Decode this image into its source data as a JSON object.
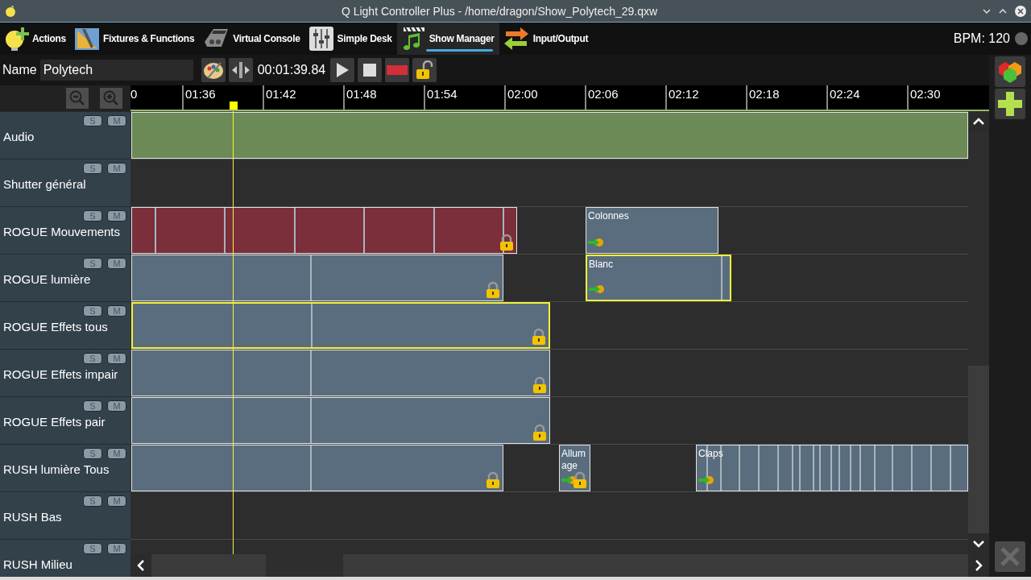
{
  "window": {
    "title": "Q Light Controller Plus - /home/dragon/Show_Polytech_29.qxw"
  },
  "tabs": [
    {
      "label": "Actions",
      "selected": false
    },
    {
      "label": "Fixtures & Functions",
      "selected": false
    },
    {
      "label": "Virtual Console",
      "selected": false
    },
    {
      "label": "Simple Desk",
      "selected": false
    },
    {
      "label": "Show Manager",
      "selected": true
    },
    {
      "label": "Input/Output",
      "selected": false
    }
  ],
  "bpm": "BPM: 120",
  "toolbar": {
    "name_label": "Name",
    "name_value": "Polytech",
    "time": "00:01:39.84"
  },
  "ruler": {
    "ticks": [
      "0",
      "01:36",
      "01:42",
      "01:48",
      "01:54",
      "02:00",
      "02:06",
      "02:12",
      "02:18",
      "02:24",
      "02:30"
    ]
  },
  "tracks": [
    {
      "name": "Audio",
      "buttons": [
        "S",
        "M"
      ],
      "items": [
        {
          "color": "#6b8a55",
          "selected": false,
          "locked": false
        }
      ]
    },
    {
      "name": "Shutter général",
      "buttons": [
        "S",
        "M"
      ]
    },
    {
      "name": "ROGUE Mouvements",
      "buttons": [
        "S",
        "M"
      ],
      "items": [
        {
          "color": "#7a2f3b",
          "selected": false,
          "locked": true
        },
        {
          "name": "Colonnes",
          "color": "#5a6d7e",
          "selected": false,
          "locked": false
        }
      ]
    },
    {
      "name": "ROGUE lumière",
      "buttons": [
        "S",
        "M"
      ],
      "items": [
        {
          "color": "#5a6d7e",
          "selected": false,
          "locked": true
        },
        {
          "name": "Blanc",
          "color": "#5a6d7e",
          "selected": true,
          "locked": false
        }
      ]
    },
    {
      "name": "ROGUE Effets tous",
      "buttons": [
        "S",
        "M"
      ],
      "items": [
        {
          "color": "#5a6d7e",
          "selected": true,
          "locked": true
        }
      ]
    },
    {
      "name": "ROGUE Effets impair",
      "buttons": [
        "S",
        "M"
      ],
      "items": [
        {
          "color": "#5a6d7e",
          "selected": false,
          "locked": true
        }
      ]
    },
    {
      "name": "ROGUE Effets pair",
      "buttons": [
        "S",
        "M"
      ],
      "items": [
        {
          "color": "#5a6d7e",
          "selected": false,
          "locked": true
        }
      ]
    },
    {
      "name": "RUSH lumière Tous",
      "buttons": [
        "S",
        "M"
      ],
      "items": [
        {
          "color": "#5a6d7e",
          "selected": false,
          "locked": true
        },
        {
          "name": "Allumage",
          "color": "#5a6d7e",
          "selected": false,
          "locked": true
        },
        {
          "name": "Claps",
          "color": "#5a6d7e",
          "selected": false,
          "locked": false
        }
      ]
    },
    {
      "name": "RUSH Bas",
      "buttons": [
        "S",
        "M"
      ]
    },
    {
      "name": "RUSH Milieu",
      "buttons": [
        "S",
        "M"
      ]
    }
  ]
}
